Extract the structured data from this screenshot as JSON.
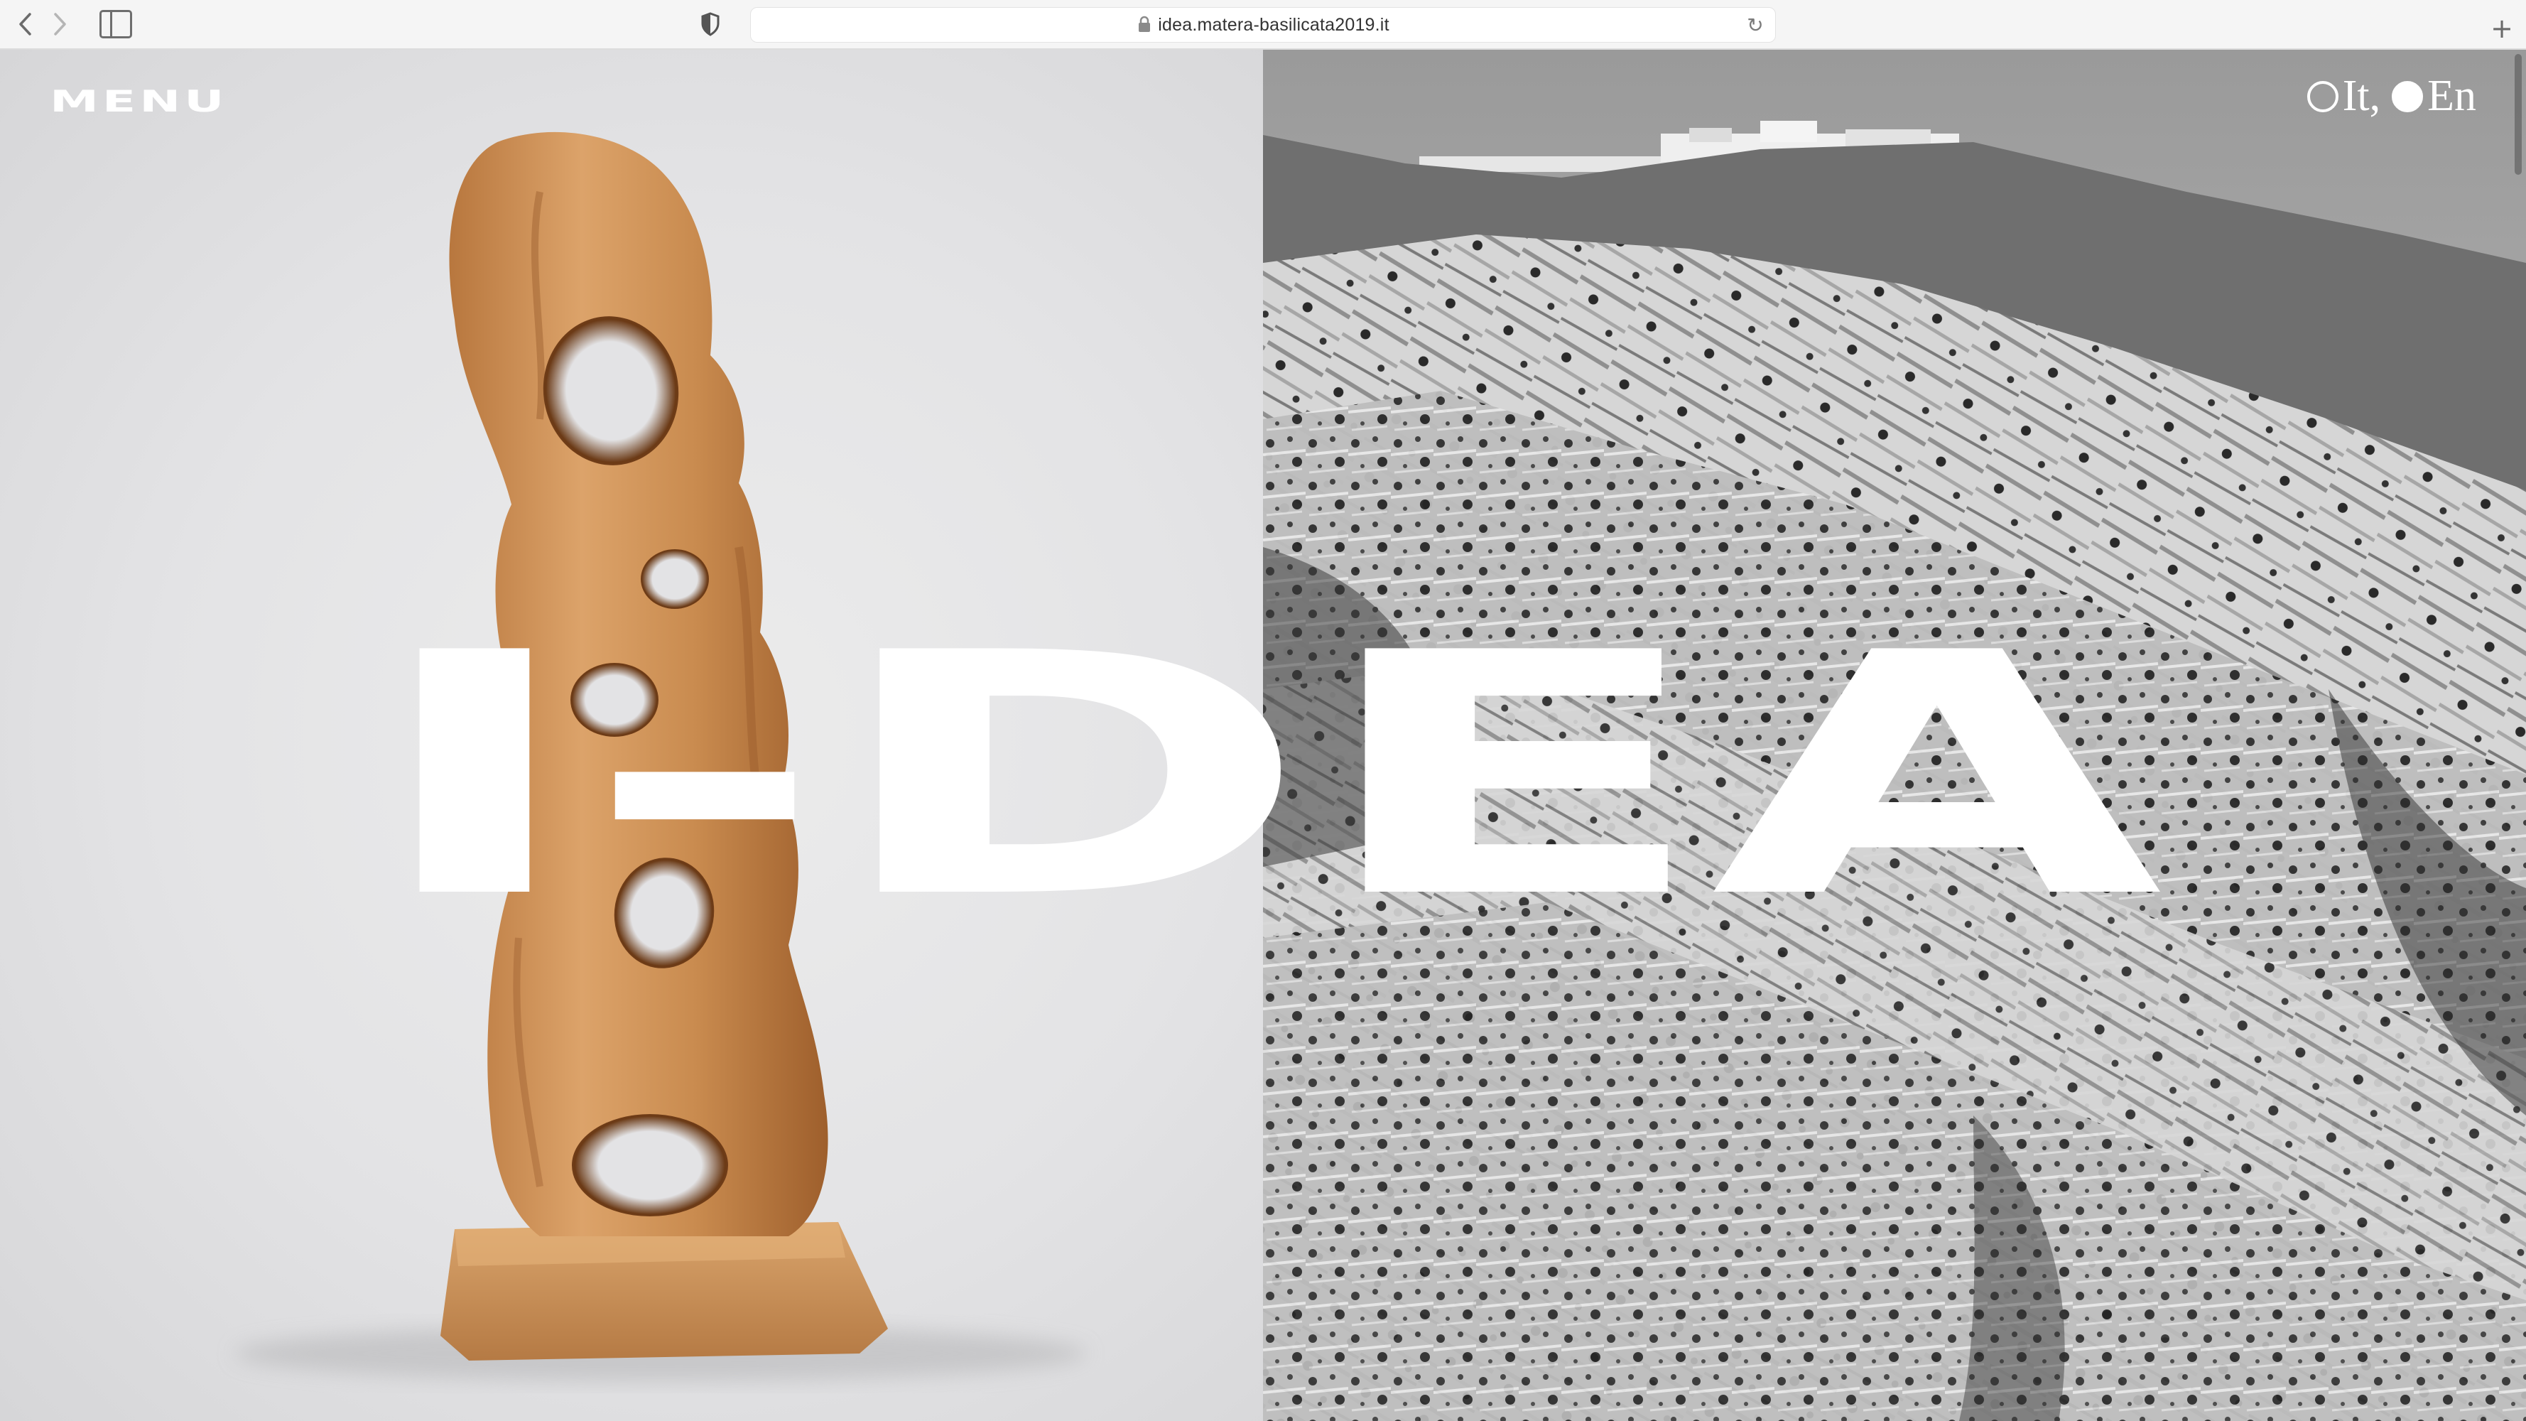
{
  "browser": {
    "url": "idea.matera-basilicata2019.it",
    "back_icon": "chevron-left-icon",
    "forward_icon": "chevron-right-icon",
    "sidebar_icon": "sidebar-icon",
    "privacy_icon": "shield-icon",
    "lock_icon": "lock-icon",
    "reload_icon": "reload-icon",
    "new_tab_icon": "plus-icon"
  },
  "header": {
    "menu_label": "MENU",
    "languages": [
      {
        "label": "It",
        "selected": false,
        "separator": ","
      },
      {
        "label": "En",
        "selected": true,
        "separator": ""
      }
    ]
  },
  "hero": {
    "title": "I-DEA",
    "left_image": "wooden-sculpture",
    "right_image": "badlands-landscape-bw"
  },
  "colors": {
    "overlay_text": "#ffffff",
    "left_background": "#e3e3e5",
    "chrome_background": "#f5f5f5"
  }
}
